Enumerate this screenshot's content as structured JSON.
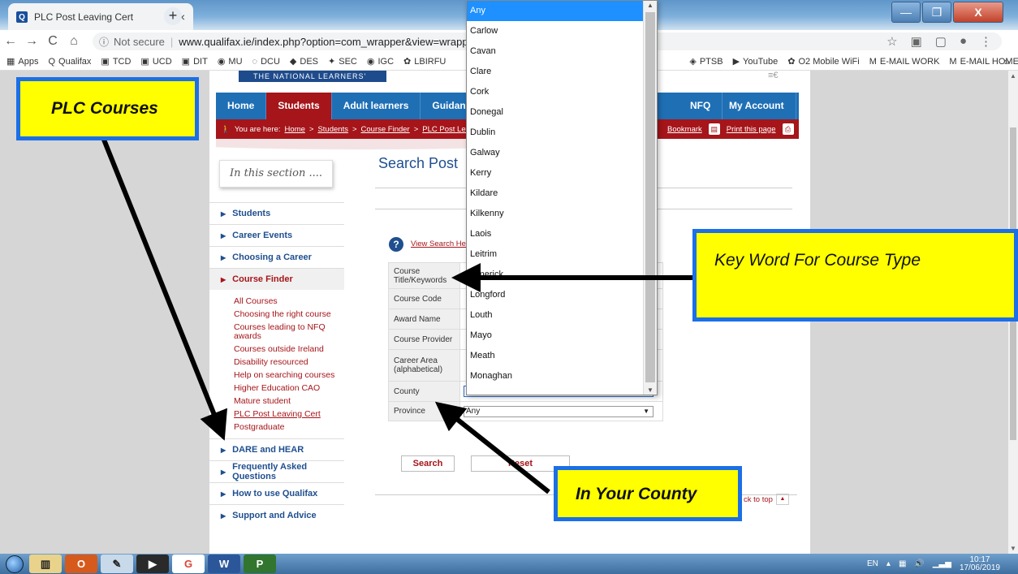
{
  "browser": {
    "tab_title": "PLC Post Leaving Cert",
    "tab_close": "×",
    "new_tab": "+",
    "omnibox_security": "Not secure",
    "omnibox_url": "www.qualifax.ie/index.php?option=com_wrapper&view=wrapper&Itemid=1",
    "window_controls": {
      "minimize": "—",
      "maximize": "❐",
      "close": "X"
    }
  },
  "bookmarks": [
    {
      "label": "Apps"
    },
    {
      "label": "Qualifax"
    },
    {
      "label": "TCD"
    },
    {
      "label": "UCD"
    },
    {
      "label": "DIT"
    },
    {
      "label": "MU"
    },
    {
      "label": "DCU"
    },
    {
      "label": "DES"
    },
    {
      "label": "SEC"
    },
    {
      "label": "IGC"
    },
    {
      "label": "LBIRFU"
    },
    {
      "label": "PTSB"
    },
    {
      "label": "YouTube"
    },
    {
      "label": "O2 Mobile WiFi"
    },
    {
      "label": "E-MAIL WORK"
    },
    {
      "label": "E-MAIL HOME"
    }
  ],
  "site": {
    "banner": "THE NATIONAL LEARNERS' DATABASE",
    "nav": [
      "Home",
      "Students",
      "Adult learners",
      "Guidance p",
      "NFQ",
      "My Account"
    ],
    "breadcrumb": {
      "prefix": "You are here:",
      "items": [
        "Home",
        "Students",
        "Course Finder",
        "PLC Post Leavi"
      ],
      "sep": ">",
      "bookmark": "Bookmark",
      "print": "Print this page"
    },
    "section_title": "In this section ....",
    "left_nav_top": [
      "Students",
      "Career Events",
      "Choosing a Career",
      "Course Finder"
    ],
    "sub_nav": [
      "All Courses",
      "Choosing the right course",
      "Courses leading to NFQ awards",
      "Courses outside Ireland",
      "Disability resourced",
      "Help on searching courses",
      "Higher Education CAO",
      "Mature student",
      "PLC Post Leaving Cert",
      "Postgraduate"
    ],
    "left_nav_bottom": [
      "DARE and HEAR",
      "Frequently Asked Questions",
      "How to use Qualifax",
      "Support and Advice"
    ],
    "page_title": "Search Post",
    "help_link": "View Search Help",
    "form_labels": [
      "Course Title/Keywords",
      "Course Code",
      "Award Name",
      "Course Provider",
      "Career Area (alphabetical)",
      "County",
      "Province"
    ],
    "county_value": "Any",
    "province_value": "Any",
    "search_button": "Search",
    "reset_button": "Reset",
    "back_to_top": "ck to top"
  },
  "dropdown_options": [
    "Any",
    "Carlow",
    "Cavan",
    "Clare",
    "Cork",
    "Donegal",
    "Dublin",
    "Galway",
    "Kerry",
    "Kildare",
    "Kilkenny",
    "Laois",
    "Leitrim",
    "Limerick",
    "Longford",
    "Louth",
    "Mayo",
    "Meath",
    "Monaghan"
  ],
  "annotations": {
    "plc": "PLC Courses",
    "keyword": "Key Word For Course Type",
    "county": "In Your County"
  },
  "taskbar": {
    "lang": "EN",
    "time": "10:17",
    "date": "17/06/2019"
  }
}
